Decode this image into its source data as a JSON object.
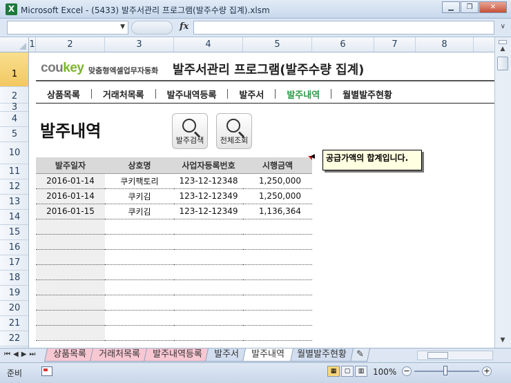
{
  "window": {
    "title": "Microsoft Excel - (5433) 발주서관리 프로그램(발주수량 집계).xlsm",
    "app_icon": "excel-icon"
  },
  "formula_bar": {
    "name_box": "",
    "fx": "fx",
    "value": ""
  },
  "columns": [
    "1",
    "2",
    "3",
    "4",
    "5",
    "6",
    "7",
    "8"
  ],
  "rows": [
    "1",
    "2",
    "3",
    "4",
    "5",
    "10",
    "11",
    "12",
    "13",
    "14",
    "15",
    "16",
    "17",
    "18",
    "19",
    "20",
    "21",
    "22"
  ],
  "banner": {
    "logo_main": "cou",
    "logo_key": "key",
    "logo_sub": "맞춤형엑셀업무자동화",
    "title": "발주서관리 프로그램(발주수량 집계)"
  },
  "menu": [
    {
      "label": "상품목록",
      "active": false
    },
    {
      "label": "거래처목록",
      "active": false
    },
    {
      "label": "발주내역등록",
      "active": false
    },
    {
      "label": "발주서",
      "active": false
    },
    {
      "label": "발주내역",
      "active": true
    },
    {
      "label": "월별발주현황",
      "active": false
    }
  ],
  "section_title": "발주내역",
  "buttons": {
    "search": "발주검색",
    "view_all": "전체조회"
  },
  "table": {
    "headers": [
      "발주일자",
      "상호명",
      "사업자등록번호",
      "시행금액"
    ],
    "rows": [
      [
        "2016-01-14",
        "쿠키팩토리",
        "123-12-12348",
        "1,250,000"
      ],
      [
        "2016-01-14",
        "쿠키김",
        "123-12-12349",
        "1,250,000"
      ],
      [
        "2016-01-15",
        "쿠키김",
        "123-12-12349",
        "1,136,364"
      ],
      [
        "",
        "",
        "",
        ""
      ],
      [
        "",
        "",
        "",
        ""
      ],
      [
        "",
        "",
        "",
        ""
      ],
      [
        "",
        "",
        "",
        ""
      ],
      [
        "",
        "",
        "",
        ""
      ],
      [
        "",
        "",
        "",
        ""
      ],
      [
        "",
        "",
        "",
        ""
      ],
      [
        "",
        "",
        "",
        ""
      ]
    ]
  },
  "comment": "공급가액의 합계입니다.",
  "sheet_tabs": [
    {
      "label": "상품목록",
      "style": "pink"
    },
    {
      "label": "거래처목록",
      "style": "pink"
    },
    {
      "label": "발주내역등록",
      "style": "pink"
    },
    {
      "label": "발주서",
      "style": "lightblue"
    },
    {
      "label": "발주내역",
      "style": "active"
    },
    {
      "label": "월별발주현황",
      "style": "lightblue"
    }
  ],
  "status": {
    "ready": "준비",
    "zoom": "100%"
  }
}
